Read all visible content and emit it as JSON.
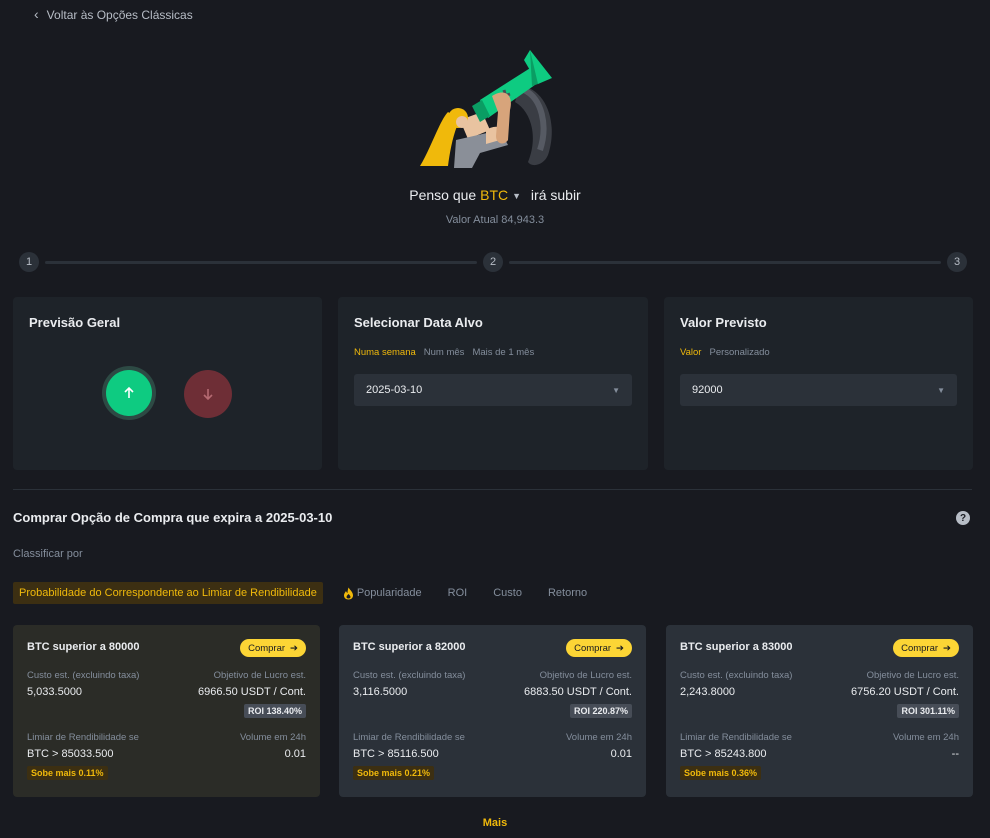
{
  "nav": {
    "back_label": "Voltar às Opções Clássicas"
  },
  "header": {
    "prefix": "Penso que",
    "coin": "BTC",
    "suffix": "irá subir",
    "current_value": "Valor Atual 84,943.3"
  },
  "steps": [
    "1",
    "2",
    "3"
  ],
  "general": {
    "title": "Previsão Geral"
  },
  "target_date": {
    "title": "Selecionar Data Alvo",
    "tabs": [
      "Numa semana",
      "Num mês",
      "Mais de 1 mês"
    ],
    "selected": "2025-03-10"
  },
  "predicted": {
    "title": "Valor Previsto",
    "tabs": [
      "Valor",
      "Personalizado"
    ],
    "selected": "92000"
  },
  "section": {
    "title": "Comprar Opção de Compra que expira a 2025-03-10",
    "sort_label": "Classificar por",
    "sort_tabs": [
      "Probabilidade do Correspondente ao Limiar de Rendibilidade",
      "Popularidade",
      "ROI",
      "Custo",
      "Retorno"
    ],
    "help": "?"
  },
  "options": [
    {
      "name": "BTC superior a 80000",
      "buy": "Comprar",
      "cost_label": "Custo est. (excluindo taxa)",
      "cost": "5,033.5000",
      "target_label": "Objetivo de Lucro est.",
      "target": "6966.50 USDT / Cont.",
      "roi": "ROI 138.40%",
      "breakeven_label": "Limiar de Rendibilidade se",
      "breakeven": "BTC > 85033.500",
      "volume_label": "Volume em 24h",
      "volume": "0.01",
      "rise": "Sobe mais 0.11%"
    },
    {
      "name": "BTC superior a 82000",
      "buy": "Comprar",
      "cost_label": "Custo est. (excluindo taxa)",
      "cost": "3,116.5000",
      "target_label": "Objetivo de Lucro est.",
      "target": "6883.50 USDT / Cont.",
      "roi": "ROI 220.87%",
      "breakeven_label": "Limiar de Rendibilidade se",
      "breakeven": "BTC > 85116.500",
      "volume_label": "Volume em 24h",
      "volume": "0.01",
      "rise": "Sobe mais 0.21%"
    },
    {
      "name": "BTC superior a 83000",
      "buy": "Comprar",
      "cost_label": "Custo est. (excluindo taxa)",
      "cost": "2,243.8000",
      "target_label": "Objetivo de Lucro est.",
      "target": "6756.20 USDT / Cont.",
      "roi": "ROI 301.11%",
      "breakeven_label": "Limiar de Rendibilidade se",
      "breakeven": "BTC > 85243.800",
      "volume_label": "Volume em 24h",
      "volume": "--",
      "rise": "Sobe mais 0.36%"
    }
  ],
  "more_label": "Mais",
  "colors": {
    "accent": "#f0b90b",
    "up": "#0ecb81",
    "down": "#f6465d",
    "bg": "#181a20",
    "card": "#1e2329"
  }
}
